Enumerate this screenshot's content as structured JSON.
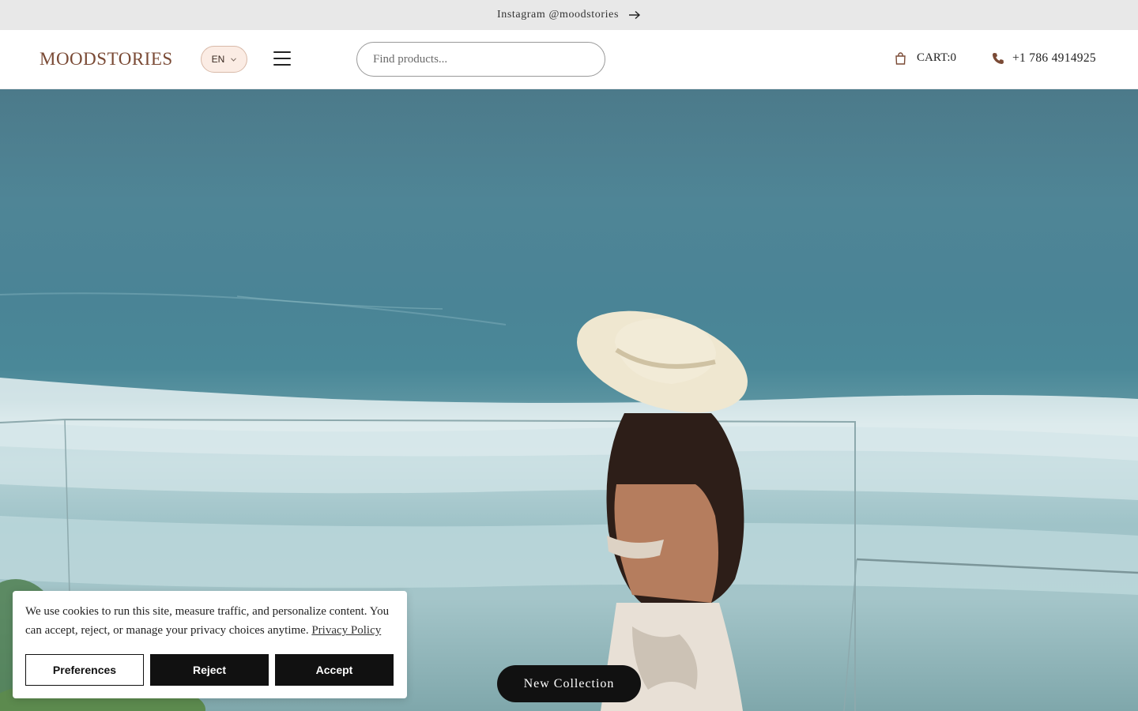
{
  "announcement": {
    "text": "Instagram @moodstories",
    "arrow_icon": "arrow-right-icon"
  },
  "header": {
    "logo": "MOODSTORIES",
    "language": "EN",
    "menu_icon": "hamburger-menu-icon",
    "search_placeholder": "Find products...",
    "cart_label": "CART:0",
    "phone": "+1 786 4914925"
  },
  "hero": {
    "cta_label": "New Collection"
  },
  "cookie_banner": {
    "message": "We use cookies to run this site, measure traffic, and personalize content. You can accept, reject, or manage your privacy choices anytime.",
    "policy_link": "Privacy Policy",
    "buttons": {
      "preferences": "Preferences",
      "reject": "Reject",
      "accept": "Accept"
    }
  },
  "colors": {
    "brand": "#7a4a35",
    "lang_bg": "#fbece4",
    "dark_button": "#111111"
  }
}
